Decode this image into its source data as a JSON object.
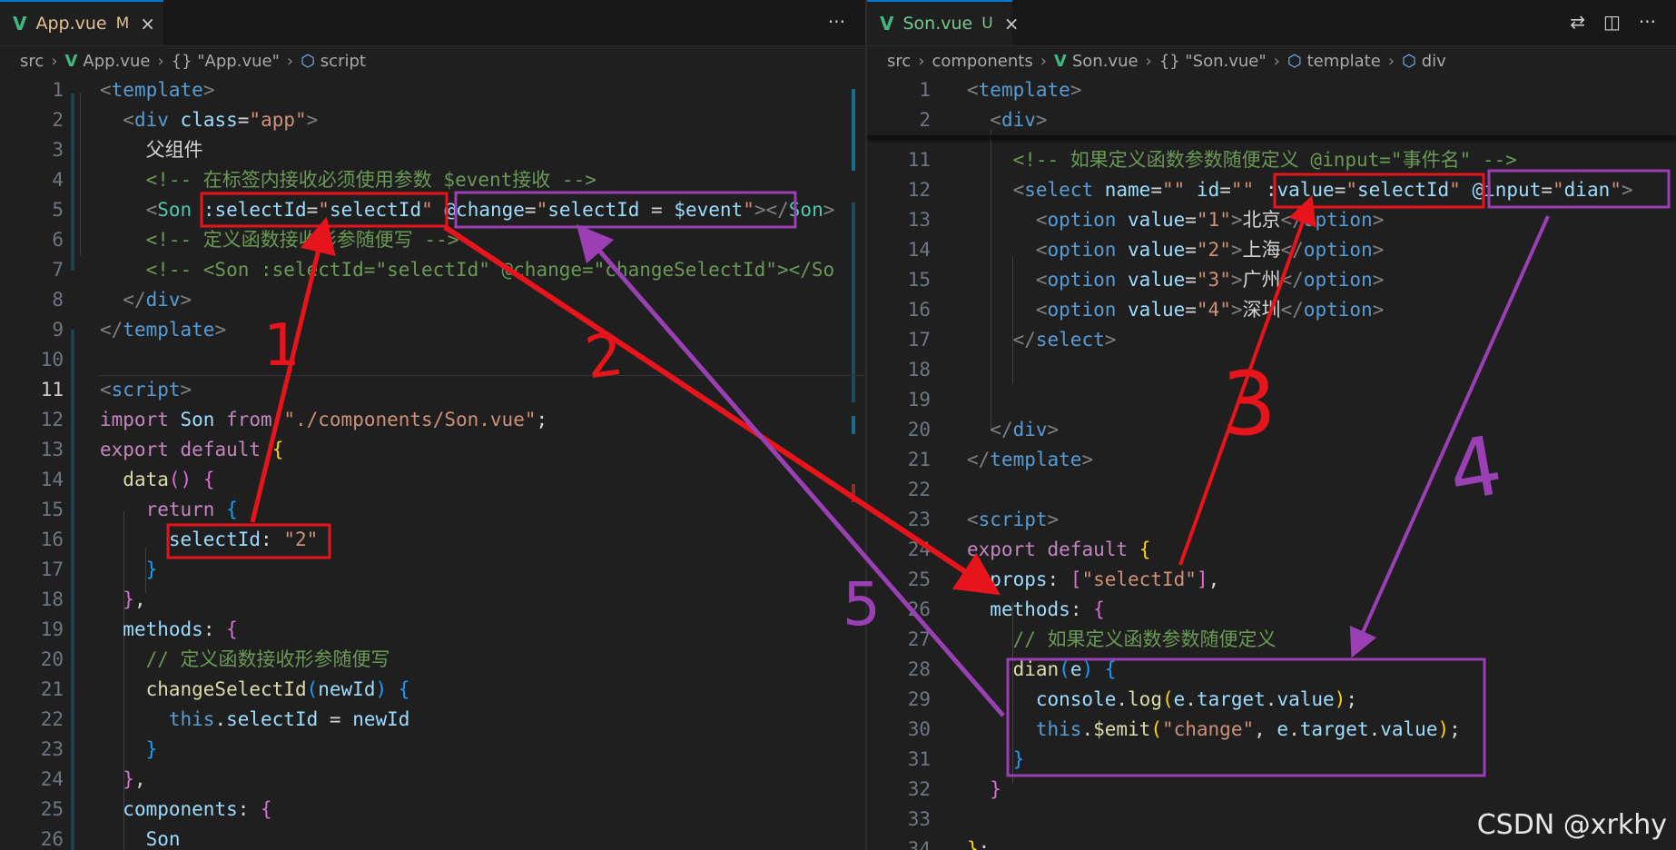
{
  "left": {
    "tab": {
      "name": "App.vue",
      "status": "M",
      "close": "×"
    },
    "actions_icon": "···",
    "breadcrumb": [
      "src",
      "App.vue",
      "{} \"App.vue\"",
      "script"
    ],
    "lines": [
      {
        "n": "1",
        "html": "<span class='t-br'>&lt;</span><span class='t-tag'>template</span><span class='t-br'>&gt;</span>"
      },
      {
        "n": "2",
        "html": "  <span class='t-br'>&lt;</span><span class='t-tag'>div</span> <span class='t-attr'>class</span>=<span class='t-str'>\"app\"</span><span class='t-br'>&gt;</span>"
      },
      {
        "n": "3",
        "html": "    <span class='t-txt'>父组件</span>"
      },
      {
        "n": "4",
        "html": "    <span class='t-com'>&lt;!-- 在标签内接收必须使用参数 $event接收 --&gt;</span>"
      },
      {
        "n": "5",
        "html": "    <span class='t-br'>&lt;</span><span class='t-cls'>Son</span> <span class='t-attr'>:selectId</span>=<span class='t-str'>\"</span><span class='t-var'>selectId</span><span class='t-str'>\"</span> <span class='t-attr'>@change</span>=<span class='t-str'>\"</span><span class='t-var'>selectId</span> = <span class='t-var'>$event</span><span class='t-str'>\"</span><span class='t-br'>&gt;&lt;/</span><span class='t-cls'>Son</span><span class='t-br'>&gt;</span>"
      },
      {
        "n": "6",
        "html": "    <span class='t-com'>&lt;!-- 定义函数接收形参随便写 --&gt;</span>"
      },
      {
        "n": "7",
        "html": "    <span class='t-com'>&lt;!-- &lt;Son :selectId=\"selectId\" @change=\"changeSelectId\"&gt;&lt;/So</span>"
      },
      {
        "n": "8",
        "html": "  <span class='t-br'>&lt;/</span><span class='t-tag'>div</span><span class='t-br'>&gt;</span>"
      },
      {
        "n": "9",
        "html": "<span class='t-br'>&lt;/</span><span class='t-tag'>template</span><span class='t-br'>&gt;</span>"
      },
      {
        "n": "10",
        "html": ""
      },
      {
        "n": "11",
        "html": "<span class='t-br'>&lt;</span><span class='t-tag'>script</span><span class='t-br'>&gt;</span>",
        "active": true
      },
      {
        "n": "12",
        "html": "<span class='t-kw'>import</span> <span class='t-var'>Son</span> <span class='t-kw'>from</span> <span class='t-str'>\"./components/Son.vue\"</span>;"
      },
      {
        "n": "13",
        "html": "<span class='t-kw'>export</span> <span class='t-kw'>default</span> <span class='t-brk1'>{</span>"
      },
      {
        "n": "14",
        "html": "  <span class='t-fn'>data</span><span class='t-brk2'>()</span> <span class='t-brk2'>{</span>"
      },
      {
        "n": "15",
        "html": "    <span class='t-kw'>return</span> <span class='t-brk3'>{</span>"
      },
      {
        "n": "16",
        "html": "      <span class='t-var'>selectId</span>: <span class='t-str'>\"2\"</span>"
      },
      {
        "n": "17",
        "html": "    <span class='t-brk3'>}</span>"
      },
      {
        "n": "18",
        "html": "  <span class='t-brk2'>}</span>,"
      },
      {
        "n": "19",
        "html": "  <span class='t-var'>methods</span>: <span class='t-brk2'>{</span>"
      },
      {
        "n": "20",
        "html": "    <span class='t-com'>// 定义函数接收形参随便写</span>"
      },
      {
        "n": "21",
        "html": "    <span class='t-fn'>changeSelectId</span><span class='t-brk3'>(</span><span class='t-var'>newId</span><span class='t-brk3'>)</span> <span class='t-brk3'>{</span>"
      },
      {
        "n": "22",
        "html": "      <span class='t-kw2'>this</span>.<span class='t-var'>selectId</span> = <span class='t-var'>newId</span>"
      },
      {
        "n": "23",
        "html": "    <span class='t-brk3'>}</span>"
      },
      {
        "n": "24",
        "html": "  <span class='t-brk2'>}</span>,"
      },
      {
        "n": "25",
        "html": "  <span class='t-var'>components</span>: <span class='t-brk2'>{</span>"
      },
      {
        "n": "26",
        "html": "    <span class='t-var'>Son</span>"
      }
    ]
  },
  "right": {
    "tab": {
      "name": "Son.vue",
      "status": "U",
      "close": "×"
    },
    "actions": [
      "⇄",
      "◫",
      "···"
    ],
    "breadcrumb": [
      "src",
      "components",
      "Son.vue",
      "{} \"Son.vue\"",
      "template",
      "div"
    ],
    "lines": [
      {
        "n": "1",
        "html": "<span class='t-br'>&lt;</span><span class='t-tag'>template</span><span class='t-br'>&gt;</span>"
      },
      {
        "n": "2",
        "html": "  <span class='t-br'>&lt;</span><span class='t-tag'>div</span><span class='t-br'>&gt;</span>"
      },
      {
        "n": "11",
        "html": "    <span class='t-com'>&lt;!-- 如果定义函数参数随便定义 @input=\"事件名\" --&gt;</span>"
      },
      {
        "n": "12",
        "html": "    <span class='t-br'>&lt;</span><span class='t-tag'>select</span> <span class='t-attr'>name</span>=<span class='t-str'>\"\"</span> <span class='t-attr'>id</span>=<span class='t-str'>\"\"</span> <span class='t-attr'>:value</span>=<span class='t-str'>\"</span><span class='t-var'>selectId</span><span class='t-str'>\"</span> <span class='t-attr'>@input</span>=<span class='t-str'>\"</span><span class='t-var'>dian</span><span class='t-str'>\"</span><span class='t-br'>&gt;</span>"
      },
      {
        "n": "13",
        "html": "      <span class='t-br'>&lt;</span><span class='t-tag'>option</span> <span class='t-attr'>value</span>=<span class='t-str'>\"1\"</span><span class='t-br'>&gt;</span>北京<span class='t-br'>&lt;/</span><span class='t-tag'>option</span><span class='t-br'>&gt;</span>"
      },
      {
        "n": "14",
        "html": "      <span class='t-br'>&lt;</span><span class='t-tag'>option</span> <span class='t-attr'>value</span>=<span class='t-str'>\"2\"</span><span class='t-br'>&gt;</span>上海<span class='t-br'>&lt;/</span><span class='t-tag'>option</span><span class='t-br'>&gt;</span>"
      },
      {
        "n": "15",
        "html": "      <span class='t-br'>&lt;</span><span class='t-tag'>option</span> <span class='t-attr'>value</span>=<span class='t-str'>\"3\"</span><span class='t-br'>&gt;</span>广州<span class='t-br'>&lt;/</span><span class='t-tag'>option</span><span class='t-br'>&gt;</span>"
      },
      {
        "n": "16",
        "html": "      <span class='t-br'>&lt;</span><span class='t-tag'>option</span> <span class='t-attr'>value</span>=<span class='t-str'>\"4\"</span><span class='t-br'>&gt;</span>深圳<span class='t-br'>&lt;/</span><span class='t-tag'>option</span><span class='t-br'>&gt;</span>"
      },
      {
        "n": "17",
        "html": "    <span class='t-br'>&lt;/</span><span class='t-tag'>select</span><span class='t-br'>&gt;</span>"
      },
      {
        "n": "18",
        "html": ""
      },
      {
        "n": "19",
        "html": ""
      },
      {
        "n": "20",
        "html": "  <span class='t-br'>&lt;/</span><span class='t-tag'>div</span><span class='t-br'>&gt;</span>"
      },
      {
        "n": "21",
        "html": "<span class='t-br'>&lt;/</span><span class='t-tag'>template</span><span class='t-br'>&gt;</span>"
      },
      {
        "n": "22",
        "html": ""
      },
      {
        "n": "23",
        "html": "<span class='t-br'>&lt;</span><span class='t-tag'>script</span><span class='t-br'>&gt;</span>"
      },
      {
        "n": "24",
        "html": "<span class='t-kw'>export</span> <span class='t-kw'>default</span> <span class='t-brk1'>{</span>"
      },
      {
        "n": "25",
        "html": "  <span class='t-var'>props</span>: <span class='t-brk2'>[</span><span class='t-str'>\"selectId\"</span><span class='t-brk2'>]</span>,"
      },
      {
        "n": "26",
        "html": "  <span class='t-var'>methods</span>: <span class='t-brk2'>{</span>"
      },
      {
        "n": "27",
        "html": "    <span class='t-com'>// 如果定义函数参数随便定义</span>"
      },
      {
        "n": "28",
        "html": "    <span class='t-fn'>dian</span><span class='t-brk3'>(</span><span class='t-var'>e</span><span class='t-brk3'>)</span> <span class='t-brk3'>{</span>"
      },
      {
        "n": "29",
        "html": "      <span class='t-var'>console</span>.<span class='t-fn'>log</span><span class='t-brk1'>(</span><span class='t-var'>e</span>.<span class='t-var'>target</span>.<span class='t-var'>value</span><span class='t-brk1'>)</span>;"
      },
      {
        "n": "30",
        "html": "      <span class='t-kw2'>this</span>.<span class='t-fn'>$emit</span><span class='t-brk1'>(</span><span class='t-str'>\"change\"</span>, <span class='t-var'>e</span>.<span class='t-var'>target</span>.<span class='t-var'>value</span><span class='t-brk1'>)</span>;"
      },
      {
        "n": "31",
        "html": "    <span class='t-brk3'>}</span>"
      },
      {
        "n": "32",
        "html": "  <span class='t-brk2'>}</span>"
      },
      {
        "n": "33",
        "html": ""
      },
      {
        "n": "34",
        "html": "<span class='t-brk1'>}</span>;"
      }
    ]
  },
  "annotations": {
    "labels": [
      "1",
      "2",
      "3",
      "4",
      "5"
    ]
  },
  "watermark": "CSDN @xrkhy",
  "colors": {
    "red": "#e8141b",
    "purple": "#9b3fb5",
    "accent": "#0078d4"
  }
}
